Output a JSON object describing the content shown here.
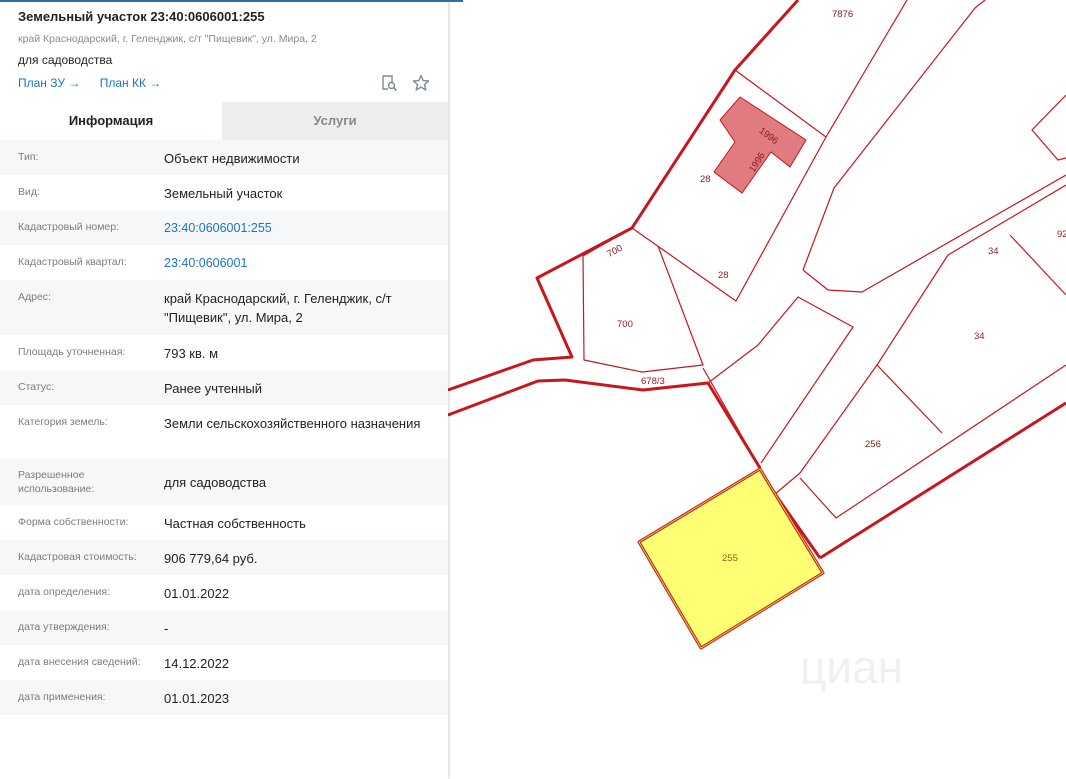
{
  "parcel": {
    "title": "Земельный участок 23:40:0606001:255",
    "address": "край Краснодарский, г. Геленджик, с/т \"Пищевик\", ул. Мира, 2",
    "purpose": "для садоводства",
    "link_plan_zu": "План ЗУ →",
    "link_plan_kk": "План КК →"
  },
  "tabs": {
    "info": "Информация",
    "services": "Услуги"
  },
  "rows": [
    {
      "label": "Тип:",
      "value": "Объект недвижимости"
    },
    {
      "label": "Вид:",
      "value": "Земельный участок"
    },
    {
      "label": "Кадастровый номер:",
      "value": "23:40:0606001:255"
    },
    {
      "label": "Кадастровый квартал:",
      "value": "23:40:0606001"
    },
    {
      "label": "Адрес:",
      "value": "край Краснодарский, г. Геленджик, с/т \"Пищевик\", ул. Мира, 2"
    },
    {
      "label": "Площадь уточненная:",
      "value": "793 кв. м"
    },
    {
      "label": "Статус:",
      "value": "Ранее учтенный"
    },
    {
      "label": "Категория земель:",
      "value": "Земли сельскохозяйственного назначения"
    },
    {
      "label": "Разрешенное использование:",
      "value": "для садоводства"
    },
    {
      "label": "Форма собственности:",
      "value": "Частная собственность"
    },
    {
      "label": "Кадастровая стоимость:",
      "value": "906 779,64 руб."
    },
    {
      "label": "дата определения:",
      "value": "01.01.2022"
    },
    {
      "label": "дата утверждения:",
      "value": "-"
    },
    {
      "label": "дата внесения сведений:",
      "value": "14.12.2022"
    },
    {
      "label": "дата применения:",
      "value": "01.01.2023"
    }
  ],
  "map": {
    "labels": {
      "l7876": "7876",
      "l1996a": "1996",
      "l1996b": "1996",
      "l28a": "28",
      "l28b": "28",
      "l700a": "700",
      "l700b": "700",
      "l678": "678/3",
      "l34a": "34",
      "l34b": "34",
      "l92": "92",
      "l256": "256",
      "l255": "255"
    },
    "watermark": "циан",
    "colors": {
      "boundary": "#c8161d",
      "selected_fill": "#ffff73",
      "building_fill": "#e07c80"
    }
  }
}
